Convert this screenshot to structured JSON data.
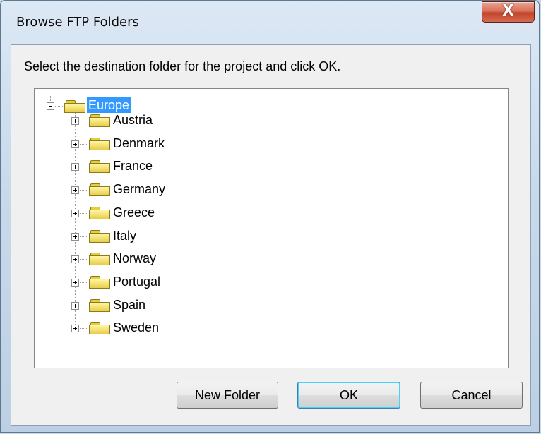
{
  "window": {
    "title": "Browse FTP Folders",
    "close_glyph": "X",
    "close_icon": "close-icon"
  },
  "prompt": "Select the destination folder for the project and click OK.",
  "tree": {
    "root": {
      "label": "Europe",
      "selected": true,
      "expanded": true,
      "icon": "folder-icon"
    },
    "children": [
      {
        "label": "Austria",
        "icon": "folder-icon",
        "expanded": false
      },
      {
        "label": "Denmark",
        "icon": "folder-icon",
        "expanded": false
      },
      {
        "label": "France",
        "icon": "folder-icon",
        "expanded": false
      },
      {
        "label": "Germany",
        "icon": "folder-icon",
        "expanded": false
      },
      {
        "label": "Greece",
        "icon": "folder-icon",
        "expanded": false
      },
      {
        "label": "Italy",
        "icon": "folder-icon",
        "expanded": false
      },
      {
        "label": "Norway",
        "icon": "folder-icon",
        "expanded": false
      },
      {
        "label": "Portugal",
        "icon": "folder-icon",
        "expanded": false
      },
      {
        "label": "Spain",
        "icon": "folder-icon",
        "expanded": false
      },
      {
        "label": "Sweden",
        "icon": "folder-icon",
        "expanded": false
      }
    ]
  },
  "buttons": {
    "new_folder": "New Folder",
    "ok": "OK",
    "cancel": "Cancel"
  },
  "colors": {
    "selection": "#3399ff",
    "close_button": "#c2452b",
    "folder": "#f3e071"
  }
}
